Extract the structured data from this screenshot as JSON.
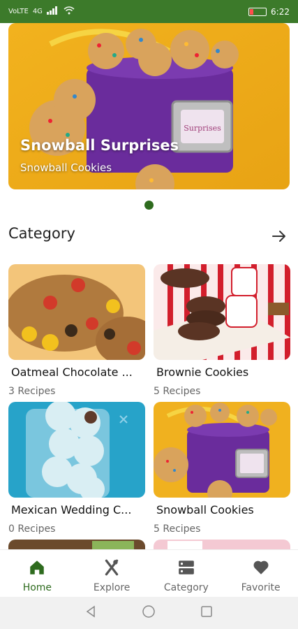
{
  "status": {
    "network": "VoLTE",
    "signal": "4G",
    "time": "6:22"
  },
  "hero": {
    "title": "Snowball Surprises",
    "subtitle": "Snowball Cookies"
  },
  "section": {
    "title": "Category"
  },
  "categories": [
    {
      "name": "Oatmeal Chocolate ...",
      "count": "3 Recipes"
    },
    {
      "name": "Brownie Cookies",
      "count": "5 Recipes"
    },
    {
      "name": "Mexican Wedding C...",
      "count": "0 Recipes"
    },
    {
      "name": "Snowball Cookies",
      "count": "5 Recipes"
    }
  ],
  "nav": [
    {
      "label": "Home"
    },
    {
      "label": "Explore"
    },
    {
      "label": "Category"
    },
    {
      "label": "Favorite"
    }
  ],
  "colors": {
    "accent": "#2e6b1e",
    "status_bar": "#3c7a2a"
  }
}
